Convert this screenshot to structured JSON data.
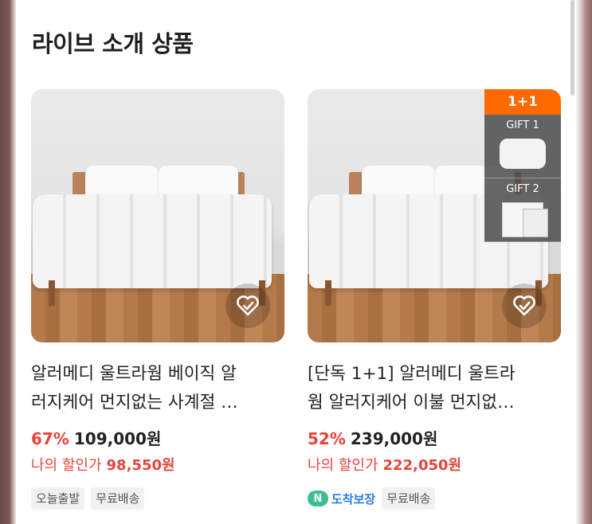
{
  "section": {
    "title": "라이브 소개 상품"
  },
  "products": [
    {
      "title_line1": "알러메디 울트라웜 베이직 알",
      "title_line2": "러지케어 먼지없는 사계절 …",
      "discount": "67%",
      "price": "109,000원",
      "my_discount_label": "나의 할인가",
      "my_discount_price": "98,550원",
      "tags": [
        "오늘출발",
        "무료배송"
      ],
      "wish_icon": "heart-check-icon"
    },
    {
      "title_line1": "[단독 1+1] 알러메디 울트라",
      "title_line2": "웜 알러지케어 이불 먼지없…",
      "discount": "52%",
      "price": "239,000원",
      "my_discount_label": "나의 할인가",
      "my_discount_price": "222,050원",
      "badge": "1+1",
      "gifts": [
        "GIFT 1",
        "GIFT 2"
      ],
      "arrival_label": "도착보장",
      "arrival_icon_text": "N",
      "tags": [
        "무료배송"
      ],
      "wish_icon": "heart-check-icon"
    }
  ],
  "colors": {
    "accent": "#e8433a",
    "badge": "#ff6a00",
    "arrival": "#2e7be0"
  }
}
